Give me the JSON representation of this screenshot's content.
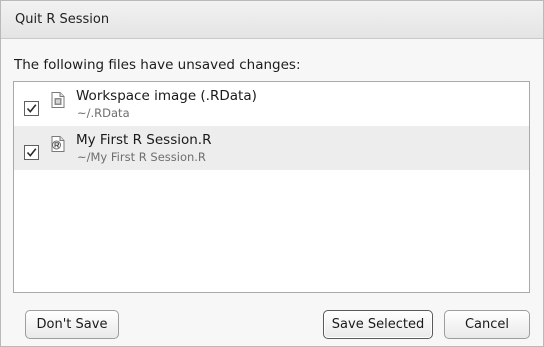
{
  "window": {
    "title": "Quit R Session"
  },
  "prompt": "The following files have unsaved changes:",
  "files": [
    {
      "name": "Workspace image (.RData)",
      "path": "~/.RData",
      "checked": true,
      "icon": "rdata-file-icon"
    },
    {
      "name": "My First R Session.R",
      "path": "~/My First R Session.R",
      "checked": true,
      "icon": "r-script-file-icon"
    }
  ],
  "buttons": {
    "dont_save": "Don't Save",
    "save_selected": "Save Selected",
    "cancel": "Cancel"
  }
}
